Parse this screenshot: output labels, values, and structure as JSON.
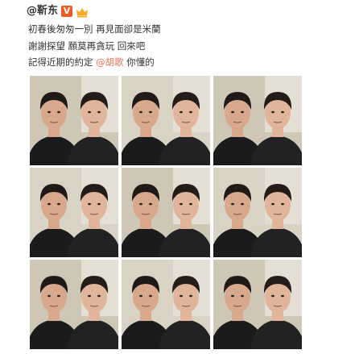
{
  "post": {
    "username": "@靳东",
    "lines": [
      {
        "text": "初春後匆匆一別 再見面卻是米蘭"
      },
      {
        "text": "謝謝探望 願莫再貪玩 回來吧"
      },
      {
        "prefix": "記得近期的約定 ",
        "mention": "@胡歌",
        "suffix": " 你懂的"
      }
    ],
    "badges": {
      "verified": "V",
      "verified_color": "#f15a22",
      "vip_color": "#f6a623"
    },
    "photos": [
      {
        "row": 0,
        "col": 0
      },
      {
        "row": 0,
        "col": 1
      },
      {
        "row": 0,
        "col": 2
      },
      {
        "row": 1,
        "col": 0
      },
      {
        "row": 1,
        "col": 1
      },
      {
        "row": 1,
        "col": 2
      },
      {
        "row": 2,
        "col": 0
      },
      {
        "row": 2,
        "col": 1
      },
      {
        "row": 2,
        "col": 2
      }
    ]
  }
}
